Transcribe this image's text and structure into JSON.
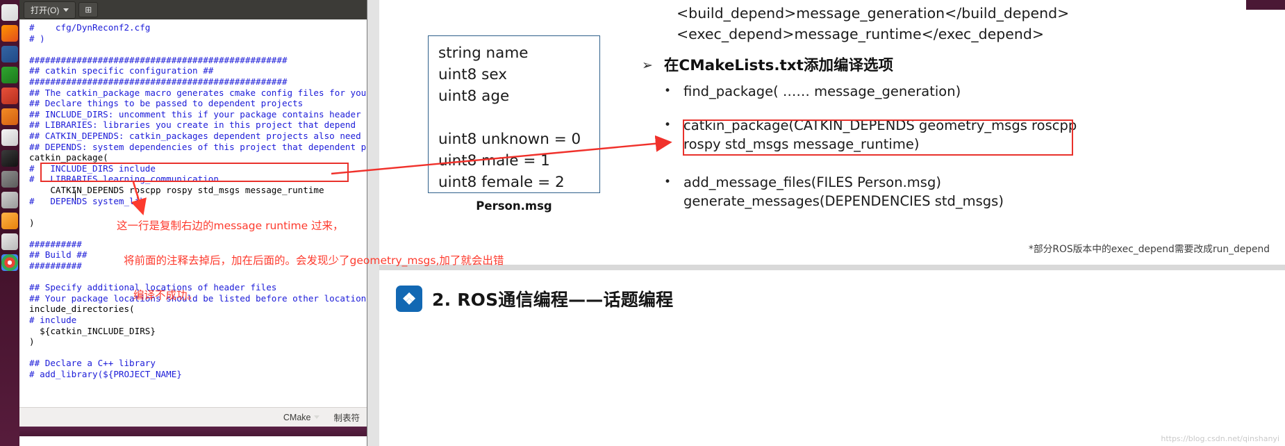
{
  "launcher": {
    "items": [
      {
        "name": "files-icon",
        "label": "Files"
      },
      {
        "name": "firefox-icon",
        "label": "Firefox"
      },
      {
        "name": "writer-icon",
        "label": "LibreOffice Writer"
      },
      {
        "name": "calc-icon",
        "label": "LibreOffice Calc"
      },
      {
        "name": "impress-icon",
        "label": "LibreOffice Impress"
      },
      {
        "name": "software-icon",
        "label": "Ubuntu Software"
      },
      {
        "name": "help-icon",
        "label": "Help"
      },
      {
        "name": "terminal-icon",
        "label": "Terminal"
      },
      {
        "name": "settings-icon",
        "label": "System Settings"
      },
      {
        "name": "trash-icon",
        "label": "Trash"
      },
      {
        "name": "amazon-icon",
        "label": "Amazon"
      },
      {
        "name": "gedit-icon",
        "label": "Text Editor"
      },
      {
        "name": "chrome-icon",
        "label": "Chrome"
      }
    ]
  },
  "editor": {
    "open_button": "打开(O)",
    "new_tab_button": "⊞",
    "code": "#    cfg/DynReconf2.cfg\n# )\n\n#################################################\n## catkin specific configuration ##\n#################################################\n## The catkin_package macro generates cmake config files for you\n## Declare things to be passed to dependent projects\n## INCLUDE_DIRS: uncomment this if your package contains header\n## LIBRARIES: libraries you create in this project that depend\n## CATKIN_DEPENDS: catkin_packages dependent projects also need\n## DEPENDS: system dependencies of this project that dependent p",
    "code_plain_1": "catkin_package(",
    "code_2": "#   INCLUDE_DIRS include\n#   LIBRARIES learning_communication",
    "code_highlight": "    CATKIN_DEPENDS roscpp rospy std_msgs message_runtime",
    "code_3": "#   DEPENDS system_lib",
    "code_4": ")",
    "code_5": "##########\n## Build ##\n##########",
    "code_6": "## Specify additional locations of header files\n## Your package locations should be listed before other location",
    "code_plain_2": "include_directories(",
    "code_7": "# include",
    "code_plain_3": "  ${catkin_INCLUDE_DIRS}\n)",
    "code_8": "## Declare a C++ library\n# add_library(${PROJECT_NAME}",
    "status_language": "CMake",
    "status_tab": "制表符"
  },
  "annotation": {
    "line1": "这一行是复制右边的message runtime 过来，",
    "line2": "将前面的注释去掉后，加在后面的。会发现少了geometry_msgs,加了就会出错",
    "line3": "编译不成功。",
    "color": "#fd3a2d"
  },
  "slide": {
    "msgbox": {
      "content": "string name\nuint8  sex\nuint8  age\n\nuint8 unknown = 0\nuint8 male    = 1\nuint8 female  = 2",
      "caption": "Person.msg",
      "border_color": "#2e5f8a"
    },
    "xml_lines": "<build_depend>message_generation</build_depend>\n<exec_depend>message_runtime</exec_depend>",
    "heading_marker": "➢",
    "heading": "在CMakeLists.txt添加编译选项",
    "bullets": [
      {
        "marker": "•",
        "text": "find_package( ……  message_generation)"
      },
      {
        "marker": "•",
        "text": "catkin_package(CATKIN_DEPENDS geometry_msgs roscpp\nrospy std_msgs message_runtime)"
      },
      {
        "marker": "•",
        "text": "add_message_files(FILES  Person.msg)\ngenerate_messages(DEPENDENCIES  std_msgs)"
      }
    ],
    "highlight_color": "#e8312b",
    "footnote": "*部分ROS版本中的exec_depend需要改成run_depend"
  },
  "slide2": {
    "icon_glyph": "❖",
    "icon_color": "#1268b3",
    "title": "2. ROS通信编程——话题编程"
  },
  "watermark": "https://blog.csdn.net/qinshanyi"
}
